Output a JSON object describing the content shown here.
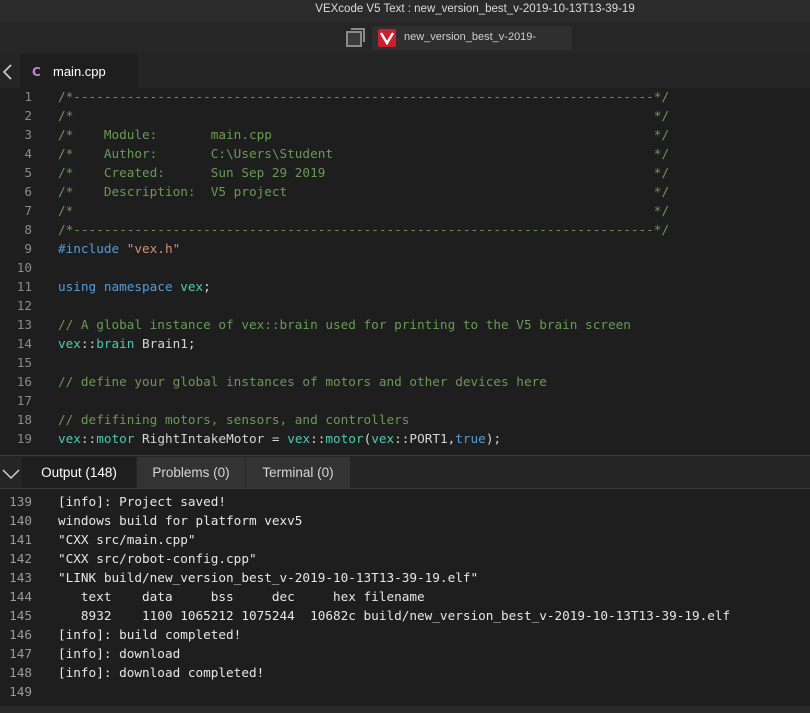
{
  "window": {
    "title": "VEXcode V5 Text : new_version_best_v-2019-10-13T13-39-19"
  },
  "taskbar": {
    "item_label": "new_version_best_v-2019-"
  },
  "editor_tab": {
    "label": "main.cpp",
    "icon": "cpp-file-icon"
  },
  "editor": {
    "lines": [
      {
        "n": "1",
        "parts": [
          {
            "t": "/*----------------------------------------------------------------------------*/",
            "c": "comment"
          }
        ]
      },
      {
        "n": "2",
        "parts": [
          {
            "t": "/*                                                                            */",
            "c": "comment"
          }
        ]
      },
      {
        "n": "3",
        "parts": [
          {
            "t": "/*    Module:       main.cpp                                                  */",
            "c": "comment"
          }
        ]
      },
      {
        "n": "4",
        "parts": [
          {
            "t": "/*    Author:       C:\\Users\\Student                                          */",
            "c": "comment"
          }
        ]
      },
      {
        "n": "5",
        "parts": [
          {
            "t": "/*    Created:      Sun Sep 29 2019                                           */",
            "c": "comment"
          }
        ]
      },
      {
        "n": "6",
        "parts": [
          {
            "t": "/*    Description:  V5 project                                                */",
            "c": "comment"
          }
        ]
      },
      {
        "n": "7",
        "parts": [
          {
            "t": "/*                                                                            */",
            "c": "comment"
          }
        ]
      },
      {
        "n": "8",
        "parts": [
          {
            "t": "/*----------------------------------------------------------------------------*/",
            "c": "comment"
          }
        ]
      },
      {
        "n": "9",
        "parts": [
          {
            "t": "#include ",
            "c": "kw"
          },
          {
            "t": "\"vex.h\"",
            "c": "str"
          }
        ]
      },
      {
        "n": "10",
        "parts": []
      },
      {
        "n": "11",
        "parts": [
          {
            "t": "using namespace ",
            "c": "kw"
          },
          {
            "t": "vex",
            "c": "type"
          },
          {
            "t": ";",
            "c": "plain"
          }
        ]
      },
      {
        "n": "12",
        "parts": []
      },
      {
        "n": "13",
        "parts": [
          {
            "t": "// A global instance of vex::brain used for printing to the V5 brain screen",
            "c": "comment"
          }
        ]
      },
      {
        "n": "14",
        "parts": [
          {
            "t": "vex",
            "c": "type"
          },
          {
            "t": "::",
            "c": "plain"
          },
          {
            "t": "brain",
            "c": "type"
          },
          {
            "t": " Brain1;",
            "c": "plain"
          }
        ]
      },
      {
        "n": "15",
        "parts": []
      },
      {
        "n": "16",
        "parts": [
          {
            "t": "// define your global instances of motors and other devices here",
            "c": "comment"
          }
        ]
      },
      {
        "n": "17",
        "parts": []
      },
      {
        "n": "18",
        "parts": [
          {
            "t": "// defifining motors, sensors, and controllers",
            "c": "comment"
          }
        ]
      },
      {
        "n": "19",
        "parts": [
          {
            "t": "vex",
            "c": "type"
          },
          {
            "t": "::",
            "c": "plain"
          },
          {
            "t": "motor",
            "c": "type"
          },
          {
            "t": " RightIntakeMotor = ",
            "c": "plain"
          },
          {
            "t": "vex",
            "c": "type"
          },
          {
            "t": "::",
            "c": "plain"
          },
          {
            "t": "motor",
            "c": "type"
          },
          {
            "t": "(",
            "c": "plain"
          },
          {
            "t": "vex",
            "c": "type"
          },
          {
            "t": "::PORT1,",
            "c": "plain"
          },
          {
            "t": "true",
            "c": "kw"
          },
          {
            "t": ");",
            "c": "plain"
          }
        ]
      }
    ]
  },
  "panel": {
    "tabs": [
      {
        "label": "Output (148)",
        "active": true
      },
      {
        "label": "Problems (0)",
        "active": false
      },
      {
        "label": "Terminal (0)",
        "active": false
      }
    ]
  },
  "output": {
    "lines": [
      {
        "n": "139",
        "text": "[info]: Project saved!"
      },
      {
        "n": "140",
        "text": "windows build for platform vexv5"
      },
      {
        "n": "141",
        "text": "\"CXX src/main.cpp\""
      },
      {
        "n": "142",
        "text": "\"CXX src/robot-config.cpp\""
      },
      {
        "n": "143",
        "text": "\"LINK build/new_version_best_v-2019-10-13T13-39-19.elf\""
      },
      {
        "n": "144",
        "text": "   text    data     bss     dec     hex filename"
      },
      {
        "n": "145",
        "text": "   8932    1100 1065212 1075244  10682c build/new_version_best_v-2019-10-13T13-39-19.elf"
      },
      {
        "n": "146",
        "text": "[info]: build completed!"
      },
      {
        "n": "147",
        "text": "[info]: download"
      },
      {
        "n": "148",
        "text": "[info]: download completed!"
      },
      {
        "n": "149",
        "text": ""
      }
    ]
  },
  "colors": {
    "comment": "#6a9955",
    "keyword": "#569cd6",
    "type": "#4ec9b0",
    "string": "#ce9178",
    "background": "#1e1e1e"
  }
}
